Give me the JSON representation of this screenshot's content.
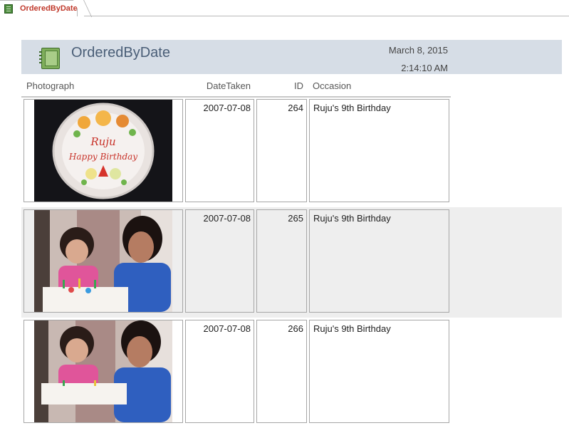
{
  "tab": {
    "label": "OrderedByDate",
    "icon": "report-icon"
  },
  "report": {
    "title": "OrderedByDate",
    "date": "March 8, 2015",
    "time": "2:14:10 AM",
    "icon": "report-icon"
  },
  "columns": {
    "photograph": "Photograph",
    "date_taken": "DateTaken",
    "id": "ID",
    "occasion": "Occasion"
  },
  "rows": [
    {
      "date_taken": "2007-07-08",
      "id": "264",
      "occasion": "Ruju's 9th Birthday",
      "photo": "birthday-cake-photo"
    },
    {
      "date_taken": "2007-07-08",
      "id": "265",
      "occasion": "Ruju's 9th Birthday",
      "photo": "children-with-cake-photo"
    },
    {
      "date_taken": "2007-07-08",
      "id": "266",
      "occasion": "Ruju's 9th Birthday",
      "photo": "children-with-cake-photo"
    }
  ],
  "colors": {
    "header_band": "#d6dde6",
    "title": "#4a5e77",
    "tab_label": "#c0392b",
    "alt_row": "#eeeeee"
  }
}
